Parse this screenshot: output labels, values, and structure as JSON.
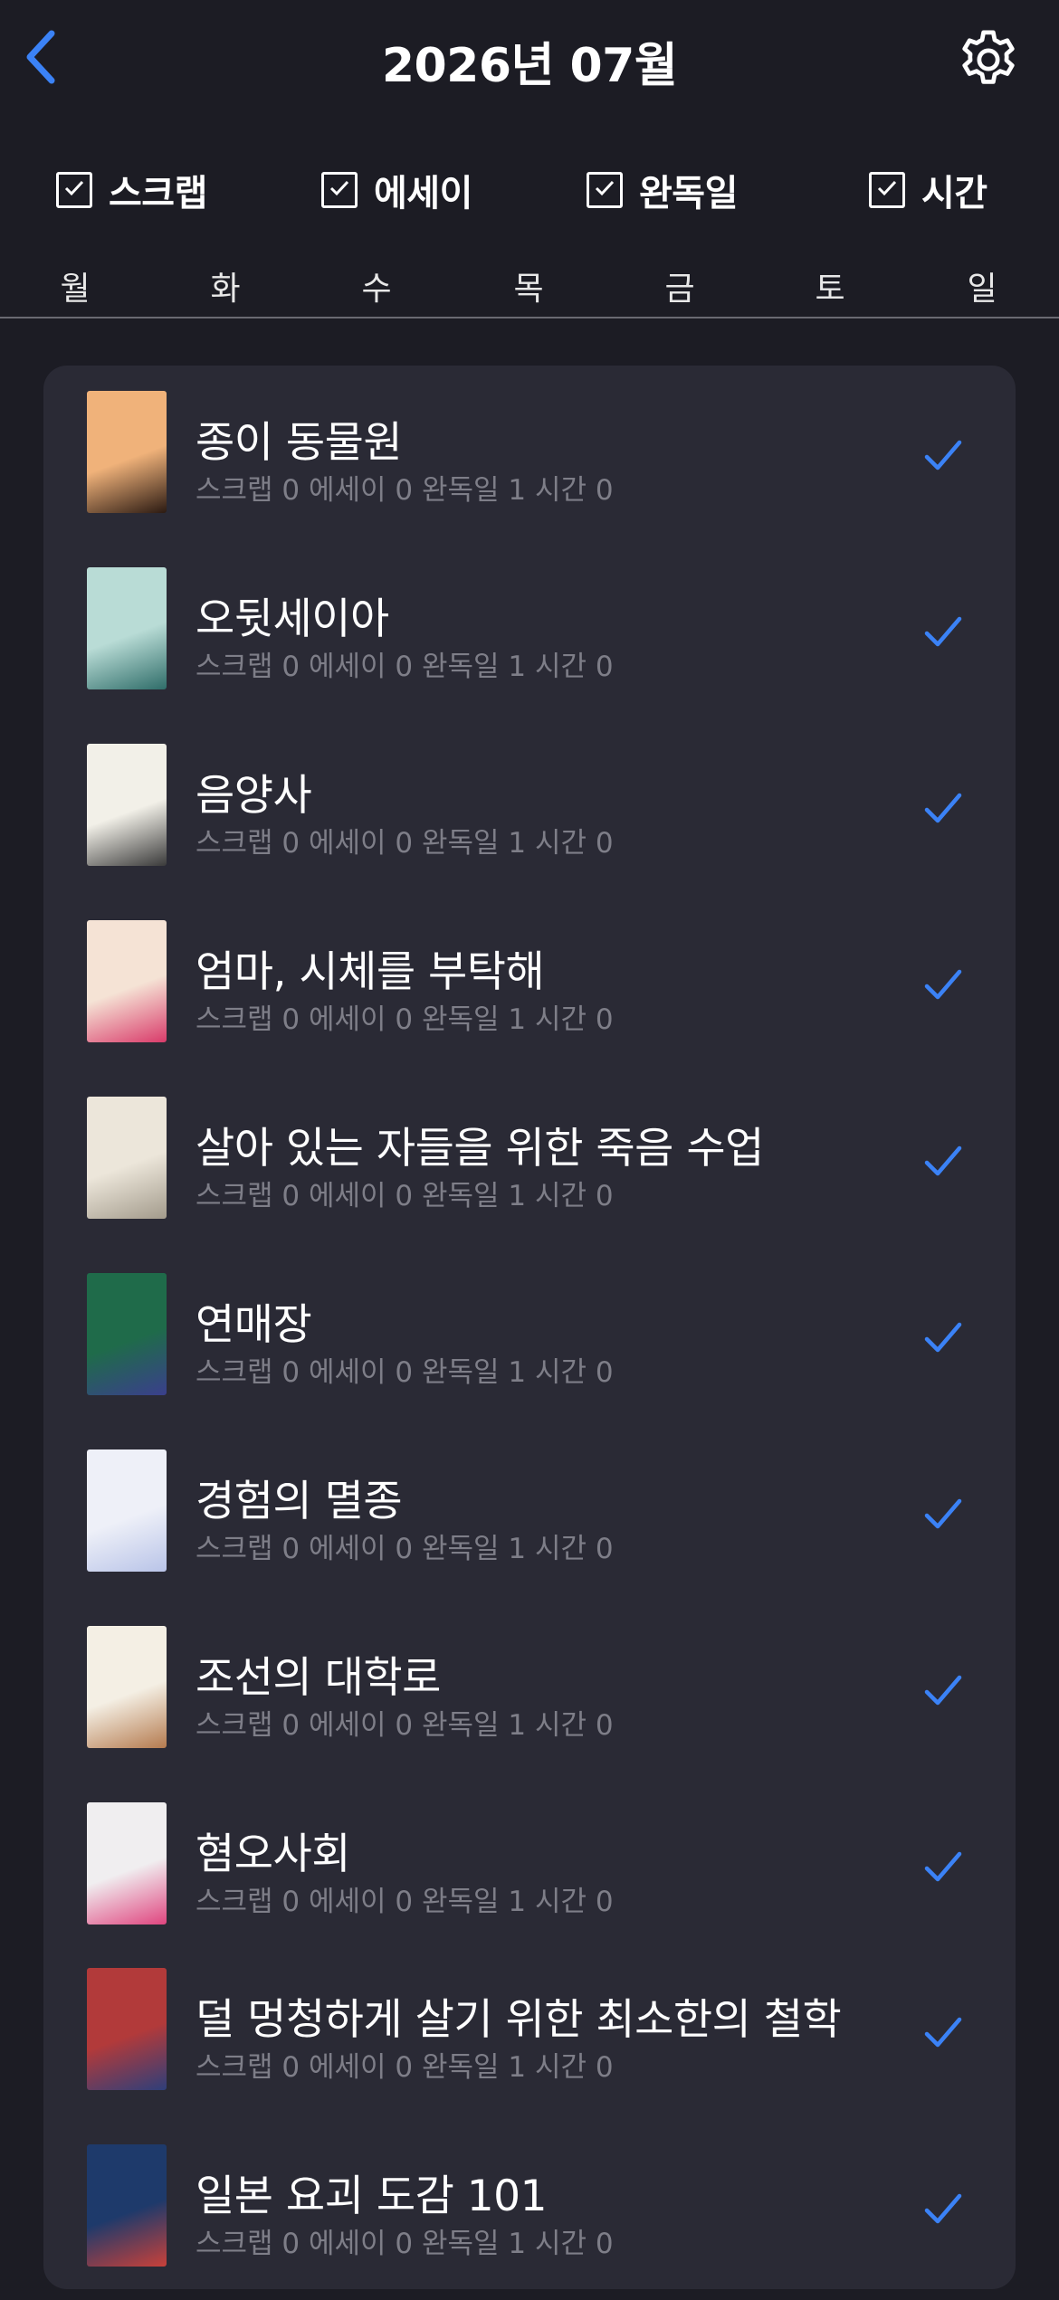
{
  "header": {
    "title": "2026년 07월",
    "back_icon": "chevron-left-icon",
    "settings_icon": "gear-icon"
  },
  "filters": [
    {
      "label": "스크랩",
      "checked": true
    },
    {
      "label": "에세이",
      "checked": true
    },
    {
      "label": "완독일",
      "checked": true
    },
    {
      "label": "시간",
      "checked": true
    }
  ],
  "weekdays": [
    "월",
    "화",
    "수",
    "목",
    "금",
    "토",
    "일"
  ],
  "books": [
    {
      "title": "종이 동물원",
      "stats": "스크랩 0 에세이 0 완독일 1 시간 0",
      "completed": true,
      "cover_colors": [
        "#f0b27a",
        "#2b1a12"
      ]
    },
    {
      "title": "오뒷세이아",
      "stats": "스크랩 0 에세이 0 완독일 1 시간 0",
      "completed": true,
      "cover_colors": [
        "#b9dcd6",
        "#2f6d69"
      ]
    },
    {
      "title": "음양사",
      "stats": "스크랩 0 에세이 0 완독일 1 시간 0",
      "completed": true,
      "cover_colors": [
        "#f2f0e8",
        "#3a3a3a"
      ]
    },
    {
      "title": "엄마, 시체를 부탁해",
      "stats": "스크랩 0 에세이 0 완독일 1 시간 0",
      "completed": true,
      "cover_colors": [
        "#f5e3d5",
        "#d93b6a"
      ]
    },
    {
      "title": "살아 있는 자들을 위한 죽음 수업",
      "stats": "스크랩 0 에세이 0 완독일 1 시간 0",
      "completed": true,
      "cover_colors": [
        "#ece6da",
        "#a39b8c"
      ]
    },
    {
      "title": "연매장",
      "stats": "스크랩 0 에세이 0 완독일 1 시간 0",
      "completed": true,
      "cover_colors": [
        "#1f6b4a",
        "#3a3f8c"
      ]
    },
    {
      "title": "경험의 멸종",
      "stats": "스크랩 0 에세이 0 완독일 1 시간 0",
      "completed": true,
      "cover_colors": [
        "#eef0f8",
        "#b9c4e8"
      ]
    },
    {
      "title": "조선의 대학로",
      "stats": "스크랩 0 에세이 0 완독일 1 시간 0",
      "completed": true,
      "cover_colors": [
        "#f4efe4",
        "#b57b4f"
      ]
    },
    {
      "title": "혐오사회",
      "stats": "스크랩 0 에세이 0 완독일 1 시간 0",
      "completed": true,
      "cover_colors": [
        "#f0eef0",
        "#e0457f"
      ]
    },
    {
      "title": "덜 멍청하게 살기 위한 최소한의 철학",
      "stats": "스크랩 0 에세이 0 완독일 1 시간 0",
      "completed": true,
      "cover_colors": [
        "#b23a3a",
        "#2e3f7a"
      ]
    },
    {
      "title": "일본 요괴 도감 101",
      "stats": "스크랩 0 에세이 0 완독일 1 시간 0",
      "completed": true,
      "cover_colors": [
        "#1e3a6b",
        "#c9413a"
      ]
    }
  ],
  "colors": {
    "background": "#1c1c24",
    "card": "#2a2a35",
    "accent": "#3b82f6",
    "subtext": "#7e7e88"
  }
}
